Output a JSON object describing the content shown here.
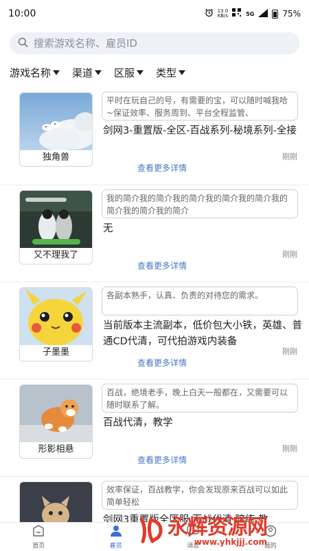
{
  "status_bar": {
    "time": "10:00",
    "speed_value": "13.0",
    "speed_unit": "KB/s",
    "network": "5G",
    "battery": "75%"
  },
  "search": {
    "placeholder": "搜索游戏名称、雇员ID"
  },
  "filters": [
    {
      "label": "游戏名称"
    },
    {
      "label": "渠道"
    },
    {
      "label": "区服"
    },
    {
      "label": "类型"
    }
  ],
  "listings": [
    {
      "name": "独角兽",
      "intro": "平时在玩自己的号，有需要的宝，可以随时喊我哈~保证效率、服务周到、平台全程监管、",
      "service": "剑网3-重置版-全区-百战系列-秘境系列-全接",
      "more_label": "查看更多详情",
      "time": "刚刚",
      "image": "sky-clouds"
    },
    {
      "name": "又不理我了",
      "intro": "我的简介我的简介我的简介我的简介我的简介我的简介我的简介我的简介",
      "service": "无",
      "more_label": "查看更多详情",
      "time": "刚刚",
      "image": "couple-scene"
    },
    {
      "name": "子墨墨",
      "intro": "各副本熟手，认真、负责的对待您的需求。",
      "service": "当前版本主流副本，低价包大小铁，英雄、普通CD代清，可代拍游戏内装备",
      "more_label": "查看更多详情",
      "time": "刚刚",
      "image": "yellow-plush"
    },
    {
      "name": "形影相悬",
      "intro": "百战，绝境老手，晚上白天一般都在，又需要可以随时联系了解。",
      "service": "百战代清，教学",
      "more_label": "查看更多详情",
      "time": "刚刚",
      "image": "puppy"
    },
    {
      "name": "",
      "intro": "效率保证，百战教学，你会发现原来百战可以如此简单轻松",
      "service": "剑网3重置版全区服 百战代清 陪练 教",
      "more_label": "",
      "time": "",
      "image": "kitten"
    }
  ],
  "bottom_nav": [
    {
      "label": "首页",
      "icon": "home-icon",
      "active": false
    },
    {
      "label": "雇员",
      "icon": "person-icon",
      "active": true
    },
    {
      "label": "消息",
      "icon": "message-icon",
      "active": false
    },
    {
      "label": "我的",
      "icon": "profile-icon",
      "active": false
    }
  ],
  "watermark": {
    "text": "永辉资源网",
    "url": "www.yhkjjj.com"
  },
  "colors": {
    "accent": "#3b6fd6",
    "link": "#4a78c4",
    "search_bg": "#eef1f7",
    "watermark": "#e03a2a"
  }
}
